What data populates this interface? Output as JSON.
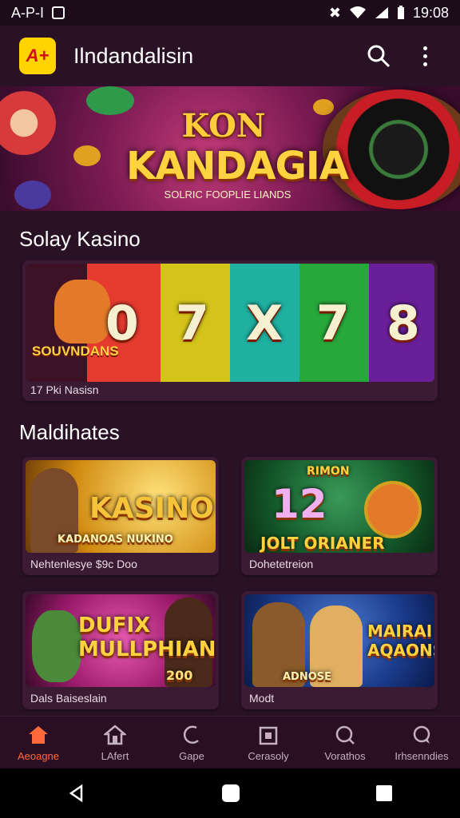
{
  "status_bar": {
    "left_text": "A-P-I",
    "time": "19:08"
  },
  "app_bar": {
    "logo_text": "A+",
    "title": "Ilndandalisin"
  },
  "banner": {
    "line1": "KON",
    "line2": "KANDAGIA",
    "line3": "SOLRIC FOOPLIE LIANDS"
  },
  "featured": {
    "title": "Solay Kasino",
    "card": {
      "caption": "17 Pki Nasisn",
      "logo": "SOUVNDANS",
      "reels": [
        "0",
        "7",
        "X",
        "7",
        "8"
      ]
    }
  },
  "more": {
    "title": "Maldihates",
    "tiles": [
      {
        "title": "KASINO",
        "subtitle": "KADANOAS NUKINO",
        "caption": "Nehtenlesye $9c Doo"
      },
      {
        "title": "JOLT ORIANER",
        "badge": "RIMON",
        "numbers": "12",
        "caption": "Dohetetreion"
      },
      {
        "title": "DUFIX MULLPHIAN",
        "badge": "200",
        "caption": "Dals Baiseslain"
      },
      {
        "title": "MAIRAI AQAONS",
        "subtitle": "ADNOSE",
        "caption": "Modt"
      }
    ]
  },
  "bottom_nav": [
    {
      "label": "Aeoagne",
      "icon": "home-icon",
      "active": true
    },
    {
      "label": "LAfert",
      "icon": "tower-icon"
    },
    {
      "label": "Gape",
      "icon": "moon-icon"
    },
    {
      "label": "Cerasoly",
      "icon": "box-icon"
    },
    {
      "label": "Vorathos",
      "icon": "search-circle-icon"
    },
    {
      "label": "Irhsenndies",
      "icon": "chat-icon"
    }
  ],
  "colors": {
    "accent": "#ff6a3d",
    "background": "#2a1226",
    "card": "#3b1a34",
    "gold": "#ffd23f"
  }
}
